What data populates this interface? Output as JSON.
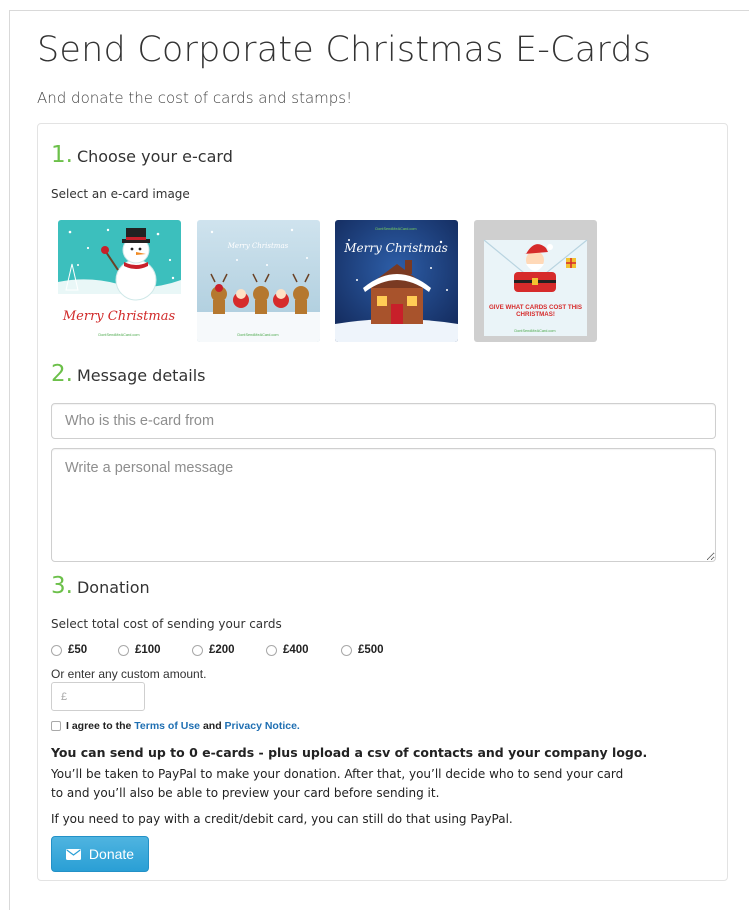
{
  "header": {
    "title": "Send Corporate Christmas E-Cards",
    "subtitle": "And donate the cost of cards and stamps!"
  },
  "step1": {
    "number": "1.",
    "heading": "Choose your e-card",
    "label": "Select an e-card image",
    "cards": [
      {
        "text": "Merry Christmas",
        "footer": "DontSendMeACard.com",
        "icon": "snowman-icon"
      },
      {
        "text": "Merry Christmas",
        "footer": "DontSendMeACard.com",
        "icon": "reindeer-santas-icon"
      },
      {
        "text": "Merry Christmas",
        "header": "DontSendMeACard.com",
        "icon": "snowy-house-icon"
      },
      {
        "text": "GIVE WHAT CARDS COST THIS CHRISTMAS!",
        "footer": "DontSendMeACard.com",
        "icon": "santa-envelope-icon"
      }
    ]
  },
  "step2": {
    "number": "2.",
    "heading": "Message details",
    "from_placeholder": "Who is this e-card from",
    "message_placeholder": "Write a personal message"
  },
  "step3": {
    "number": "3.",
    "heading": "Donation",
    "label": "Select total cost of sending your cards",
    "amounts": [
      "£50",
      "£100",
      "£200",
      "£400",
      "£500"
    ],
    "custom_label": "Or enter any custom amount.",
    "custom_placeholder": "£",
    "agree_prefix": "I agree to the",
    "terms_link": "Terms of Use",
    "agree_and": "and",
    "privacy_link": "Privacy Notice.",
    "info_bold": "You can send up to 0 e-cards - plus upload a csv of contacts and your company logo.",
    "info_paypal": "You’ll be taken to PayPal to make your donation. After that, you’ll decide who to send your card to and you’ll also be able to preview your card before sending it.",
    "info_card": "If you need to pay with a credit/debit card, you can still do that using PayPal.",
    "donate_label": "Donate"
  },
  "colors": {
    "step_number": "#6cc04a",
    "link": "#1f6fb2",
    "button": "#2a9fd5"
  }
}
